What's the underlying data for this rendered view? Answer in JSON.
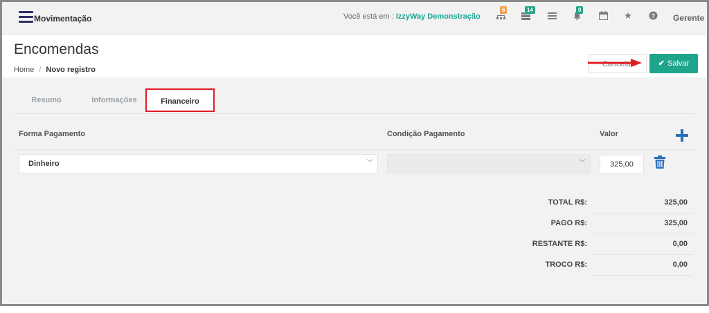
{
  "app": {
    "title": "Movimentação"
  },
  "topbar": {
    "location_prefix": "Você está em :",
    "location_name": "IzzyWay Demonstração",
    "badges": {
      "sitemap": "6",
      "grid": "14",
      "bell": "0"
    },
    "badge_colors": {
      "sitemap": "#f0a04b",
      "grid": "#1fa58b",
      "bell": "#1fa58b"
    },
    "icons": [
      "sitemap-icon",
      "grid-icon",
      "list-icon",
      "bell-icon",
      "calendar-icon",
      "star-icon",
      "help-icon"
    ],
    "user": "Gerente"
  },
  "header": {
    "title": "Encomendas",
    "breadcrumb": {
      "home": "Home",
      "separator": "/",
      "current": "Novo registro"
    },
    "cancel_label": "Cancelar",
    "save_label": "Salvar"
  },
  "tabs": [
    {
      "label": "Resumo"
    },
    {
      "label": "Informações"
    },
    {
      "label": "Financeiro",
      "active": true
    }
  ],
  "payment": {
    "columns": {
      "forma": "Forma Pagamento",
      "condicao": "Condição Pagamento",
      "valor": "Valor"
    },
    "row": {
      "forma": "Dinheiro",
      "condicao": "",
      "valor": "325,00"
    }
  },
  "totals": [
    {
      "label": "TOTAL R$:",
      "value": "325,00"
    },
    {
      "label": "PAGO R$:",
      "value": "325,00"
    },
    {
      "label": "RESTANTE R$:",
      "value": "0,00"
    },
    {
      "label": "TROCO R$:",
      "value": "0,00"
    }
  ],
  "colors": {
    "accent": "#1fa58b",
    "highlight": "#e11b22",
    "brand": "#2d2e6b",
    "add": "#2d6fb8"
  }
}
